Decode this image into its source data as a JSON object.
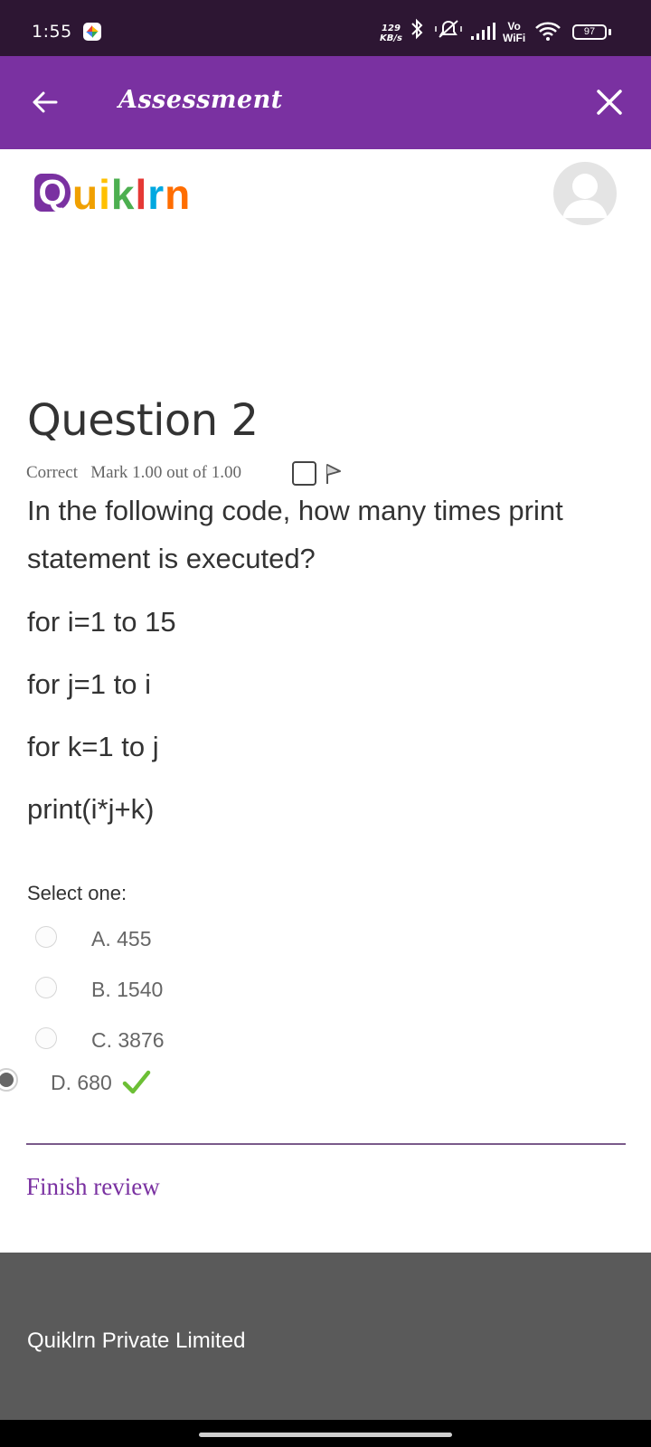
{
  "status_bar": {
    "time": "1:55",
    "net_speed_value": "129",
    "net_speed_unit": "KB/s",
    "vowifi_top": "Vo",
    "vowifi_bottom": "WiFi",
    "battery": "97"
  },
  "app_bar": {
    "title": "Assessment"
  },
  "logo": {
    "q": "Q",
    "rest": [
      "u",
      "i",
      "k",
      "l",
      "r",
      "n"
    ],
    "colors": [
      "#f0a000",
      "#ffc000",
      "#4caf50",
      "#e53935",
      "#00a8e0",
      "#ff6d00"
    ],
    "brand_color": "#7a31a1"
  },
  "question": {
    "title": "Question 2",
    "status": "Correct",
    "mark": "Mark 1.00 out of 1.00",
    "text": "In the following code, how many times print statement is executed?",
    "code": [
      "for i=1 to 15",
      "for j=1 to i",
      "for k=1 to j",
      "print(i*j+k)"
    ],
    "prompt": "Select one:",
    "options": [
      {
        "label": "A. 455"
      },
      {
        "label": "B. 1540"
      },
      {
        "label": "C. 3876"
      },
      {
        "label": "D. 680",
        "selected": true,
        "correct": true
      }
    ]
  },
  "finish_review": "Finish review",
  "footer": {
    "company": "Quiklrn Private Limited"
  }
}
